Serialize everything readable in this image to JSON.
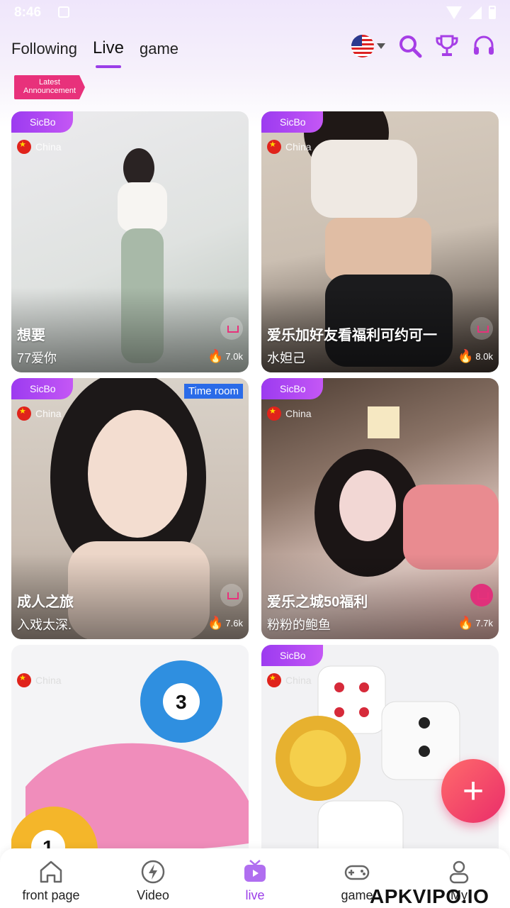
{
  "status": {
    "time": "8:46"
  },
  "header": {
    "tabs": [
      {
        "label": "Following"
      },
      {
        "label": "Live"
      },
      {
        "label": "game"
      }
    ]
  },
  "announcement": {
    "line1": "Latest",
    "line2": "Announcement"
  },
  "cards": [
    {
      "tag": "SicBo",
      "country": "China",
      "title": "想要",
      "subtitle": "77爱你",
      "views": "7.0k",
      "colors": [
        "#e9e7ea",
        "#cfd5d0"
      ]
    },
    {
      "tag": "SicBo",
      "country": "China",
      "title": "爱乐加好友看福利可约可一",
      "subtitle": "水妲己",
      "views": "8.0k",
      "colors": [
        "#d9cfc4",
        "#2a2320"
      ]
    },
    {
      "tag": "SicBo",
      "country": "China",
      "title": "成人之旅",
      "subtitle": "入戏太深.",
      "views": "7.6k",
      "badge": "Time room",
      "colors": [
        "#d8cfc4",
        "#9f8f84"
      ]
    },
    {
      "tag": "SicBo",
      "country": "China",
      "title": "爱乐之城50福利",
      "subtitle": "粉粉的鲍鱼",
      "views": "7.7k",
      "colors": [
        "#5a4a40",
        "#d9b0a8"
      ]
    },
    {
      "country": "China",
      "colors": [
        "#f5f5f7",
        "#f0a7c8"
      ]
    },
    {
      "tag": "SicBo",
      "country": "China",
      "colors": [
        "#f3f3f5",
        "#e6c070"
      ]
    }
  ],
  "nav": [
    {
      "label": "front page",
      "icon": "home-icon"
    },
    {
      "label": "Video",
      "icon": "bolt-icon"
    },
    {
      "label": "live",
      "icon": "tv-icon"
    },
    {
      "label": "game",
      "icon": "gamepad-icon"
    },
    {
      "label": "My",
      "icon": "user-icon"
    }
  ],
  "watermark": "APKVIPO.IO"
}
